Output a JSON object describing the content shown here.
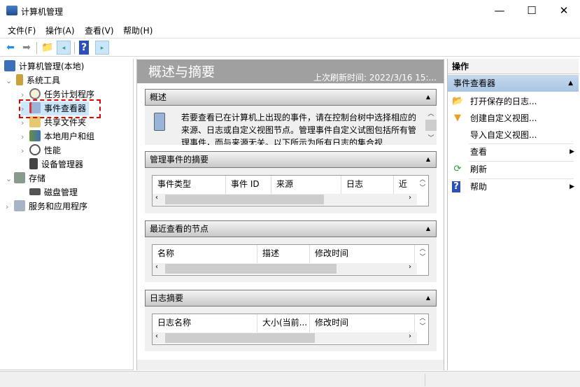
{
  "window": {
    "title": "计算机管理",
    "minimize": "—",
    "maximize": "☐",
    "close": "✕"
  },
  "menu": [
    "文件(F)",
    "操作(A)",
    "查看(V)",
    "帮助(H)"
  ],
  "toolbar": {
    "icons": [
      "back-arrow-icon",
      "forward-arrow-icon",
      "up-folder-icon",
      "show-hide-console-tree-icon",
      "help-icon",
      "show-hide-action-pane-icon"
    ]
  },
  "tree": [
    {
      "label": "计算机管理(本地)",
      "level": 0,
      "chevron": "",
      "icon": "computer-management-icon"
    },
    {
      "label": "系统工具",
      "level": 1,
      "chevron": "expanded",
      "icon": "system-tools-icon"
    },
    {
      "label": "任务计划程序",
      "level": 2,
      "chevron": "collapsed",
      "icon": "task-scheduler-icon"
    },
    {
      "label": "事件查看器",
      "level": 2,
      "chevron": "collapsed",
      "icon": "event-viewer-icon",
      "selected": true
    },
    {
      "label": "共享文件夹",
      "level": 2,
      "chevron": "collapsed",
      "icon": "shared-folders-icon"
    },
    {
      "label": "本地用户和组",
      "level": 2,
      "chevron": "collapsed",
      "icon": "local-users-icon"
    },
    {
      "label": "性能",
      "level": 2,
      "chevron": "collapsed",
      "icon": "performance-icon"
    },
    {
      "label": "设备管理器",
      "level": 2,
      "chevron": "",
      "icon": "device-manager-icon"
    },
    {
      "label": "存储",
      "level": 1,
      "chevron": "expanded",
      "icon": "storage-icon"
    },
    {
      "label": "磁盘管理",
      "level": 2,
      "chevron": "",
      "icon": "disk-management-icon"
    },
    {
      "label": "服务和应用程序",
      "level": 1,
      "chevron": "collapsed",
      "icon": "services-apps-icon"
    }
  ],
  "main": {
    "title": "概述与摘要",
    "refresh_time": "上次刷新时间: 2022/3/16 15:...",
    "overview": {
      "header": "概述",
      "text": "若要查看已在计算机上出现的事件，请在控制台树中选择相应的来源、日志或自定义视图节点。管理事件自定义试图包括所有管理事件，而与来源无关。以下所示为所有日志的集合视"
    },
    "sections": [
      {
        "header": "管理事件的摘要",
        "columns": [
          "事件类型",
          "事件 ID",
          "来源",
          "日志",
          "近"
        ],
        "scroll_fraction": 0.6
      },
      {
        "header": "最近查看的节点",
        "columns": [
          "名称",
          "描述",
          "修改时间"
        ],
        "scroll_fraction": 0.66
      },
      {
        "header": "日志摘要",
        "columns": [
          "日志名称",
          "大小(当前...",
          "修改时间"
        ],
        "scroll_fraction": 0.58
      }
    ]
  },
  "actions": {
    "header": "操作",
    "group": "事件查看器",
    "items": [
      {
        "label": "打开保存的日志...",
        "icon": "open-folder-icon"
      },
      {
        "label": "创建自定义视图...",
        "icon": "filter-icon"
      },
      {
        "label": "导入自定义视图...",
        "icon": ""
      },
      {
        "label": "查看",
        "icon": "",
        "submenu": true
      },
      {
        "label": "刷新",
        "icon": "refresh-icon"
      },
      {
        "label": "帮助",
        "icon": "help-icon",
        "submenu": true
      }
    ]
  }
}
